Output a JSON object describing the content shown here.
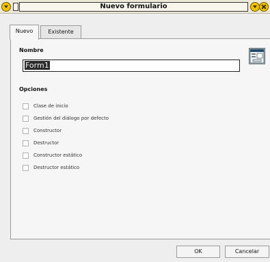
{
  "window": {
    "title": "Nuevo formulario"
  },
  "tabs": {
    "items": [
      {
        "label": "Nuevo",
        "active": true
      },
      {
        "label": "Existente",
        "active": false
      }
    ]
  },
  "form": {
    "name_section_title": "Nombre",
    "name_value": "Form1",
    "options_section_title": "Opciones",
    "options": [
      {
        "label": "Clase de inicio",
        "checked": false
      },
      {
        "label": "Gestión del diálogo por defecto",
        "checked": false
      },
      {
        "label": "Constructor",
        "checked": false
      },
      {
        "label": "Destructor",
        "checked": false
      },
      {
        "label": "Constructor estático",
        "checked": false
      },
      {
        "label": "Destructor estático",
        "checked": false
      }
    ]
  },
  "buttons": {
    "ok": "OK",
    "cancel": "Cancelar"
  },
  "icons": {
    "window_menu": "window-menu-icon",
    "minimize": "minimize-icon",
    "close": "close-icon",
    "form_preview": "form-preview-icon"
  }
}
